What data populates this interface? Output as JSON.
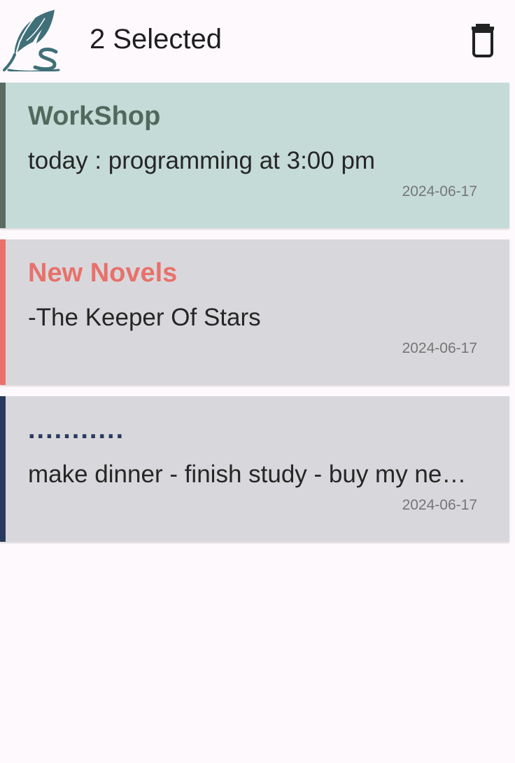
{
  "app_bar": {
    "selection_label": "2 Selected",
    "logo_icon": "quill-feather-s-logo",
    "delete_icon": "trash-icon"
  },
  "colors": {
    "background": "#fdf9fc",
    "selected_card": "#c5dbd8",
    "unselected_card": "#d8d8dc",
    "delete_icon": "#222222"
  },
  "notes": [
    {
      "title": "WorkShop",
      "body": "today : programming at 3:00 pm",
      "date": "2024-06-17",
      "accent_color": "#5b6b61",
      "background": "#c5dbd8",
      "selected": true
    },
    {
      "title": "New Novels",
      "body": "-The Keeper Of Stars",
      "date": "2024-06-17",
      "accent_color": "#e8716b",
      "background": "#d8d8dc",
      "selected": false
    },
    {
      "title": "...........",
      "body": "make dinner - finish study - buy my new book",
      "date": "2024-06-17",
      "accent_color": "#2a3a5e",
      "background": "#d8d8dc",
      "selected": false
    }
  ]
}
